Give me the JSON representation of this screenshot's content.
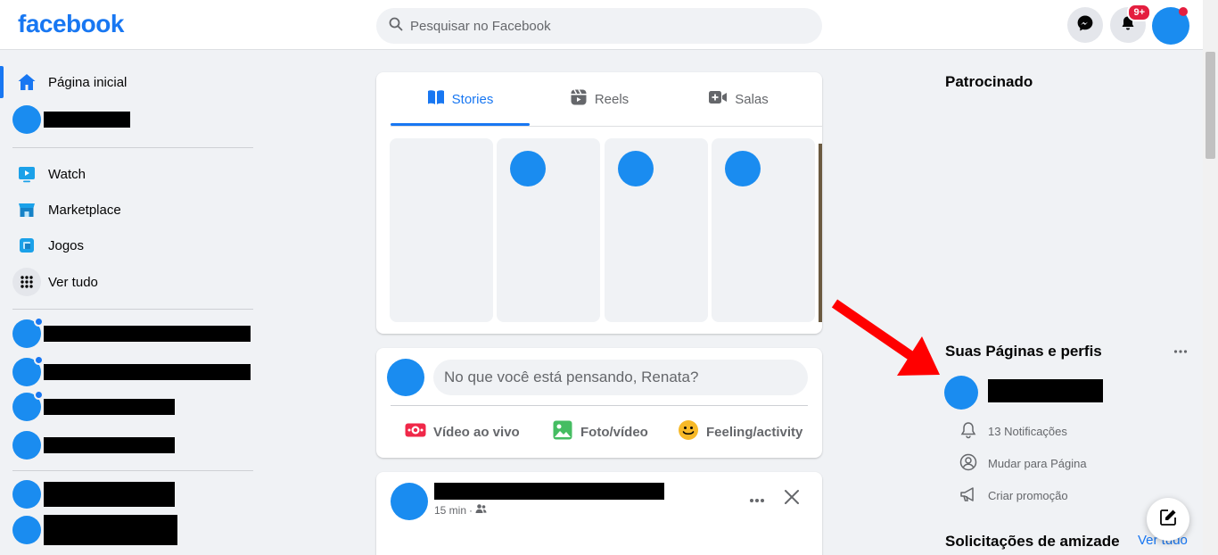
{
  "brand": {
    "logo_text": "facebook",
    "color": "#1877f2"
  },
  "header": {
    "search_placeholder": "Pesquisar no Facebook",
    "notifications_badge": "9+"
  },
  "sidebar": {
    "items": [
      {
        "label": "Página inicial",
        "icon": "home-icon"
      },
      {
        "label": "Watch",
        "icon": "watch-icon"
      },
      {
        "label": "Marketplace",
        "icon": "marketplace-icon"
      },
      {
        "label": "Jogos",
        "icon": "games-icon"
      },
      {
        "label": "Ver tudo",
        "icon": "grid-icon"
      }
    ]
  },
  "stories": {
    "tabs": [
      {
        "label": "Stories",
        "icon": "book-icon"
      },
      {
        "label": "Reels",
        "icon": "reels-icon"
      },
      {
        "label": "Salas",
        "icon": "video-camera-icon"
      }
    ]
  },
  "composer": {
    "placeholder": "No que você está pensando, Renata?",
    "actions": [
      {
        "label": "Vídeo ao vivo",
        "icon": "live-video-icon",
        "color": "#f02849"
      },
      {
        "label": "Foto/vídeo",
        "icon": "photo-icon",
        "color": "#45bd62"
      },
      {
        "label": "Feeling/activity",
        "icon": "smiley-icon",
        "color": "#f7b928"
      }
    ]
  },
  "post": {
    "time": "15 min",
    "separator": "·"
  },
  "right": {
    "sponsored": "Patrocinado",
    "pages_heading": "Suas Páginas e perfis",
    "page_actions": [
      {
        "label": "13 Notificações",
        "icon": "bell-icon"
      },
      {
        "label": "Mudar para Página",
        "icon": "switch-profile-icon"
      },
      {
        "label": "Criar promoção",
        "icon": "megaphone-icon"
      }
    ],
    "friend_requests": "Solicitações de amizade",
    "see_all": "Ver tudo"
  },
  "colors": {
    "accent": "#1877f2",
    "avatar": "#1a8cf0",
    "annotation_arrow": "#ff0000"
  }
}
